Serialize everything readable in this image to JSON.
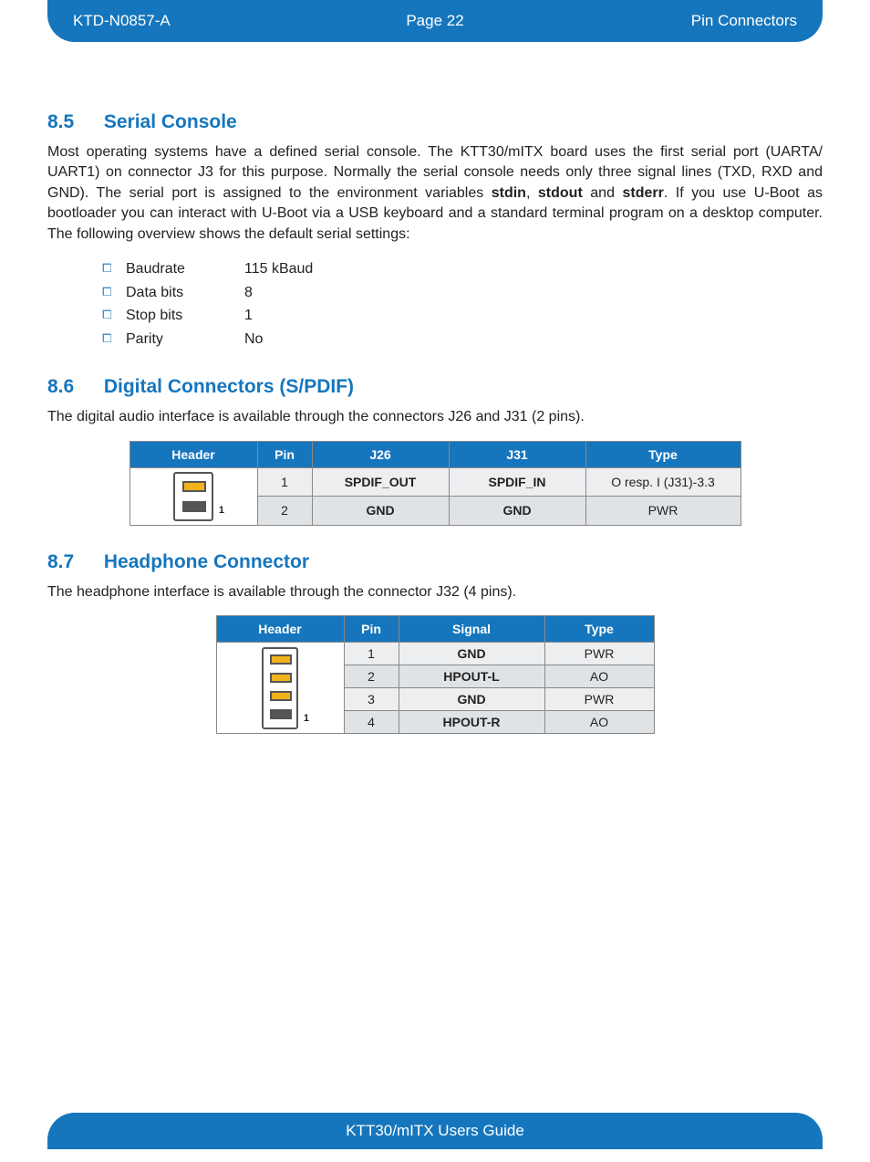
{
  "header": {
    "left": "KTD-N0857-A",
    "mid": "Page 22",
    "right": "Pin Connectors"
  },
  "footer": "KTT30/mITX Users Guide",
  "s85": {
    "num": "8.5",
    "title": "Serial Console",
    "para_pre": "Most operating systems have a defined serial console. The KTT30/mITX board uses the first serial port (UARTA/ UART1) on connector J3 for this purpose. Normally the serial console needs only three signal lines (TXD, RXD and GND). The serial port is assigned to the environment variables ",
    "b1": "stdin",
    "c1": ", ",
    "b2": "stdout",
    "c2": " and ",
    "b3": "stderr",
    "para_post": ". If you use U-Boot as bootloader you can interact with U-Boot via a USB keyboard and a standard terminal program on a desktop computer. The following overview shows the default serial settings:",
    "bullets": [
      {
        "label": "Baudrate",
        "value": "115 kBaud"
      },
      {
        "label": "Data bits",
        "value": "8"
      },
      {
        "label": "Stop bits",
        "value": "1"
      },
      {
        "label": "Parity",
        "value": "No"
      }
    ]
  },
  "s86": {
    "num": "8.6",
    "title": "Digital Connectors (S/PDIF)",
    "para": "The digital audio interface is available through the connectors J26 and J31 (2 pins).",
    "th": {
      "c0": "Header",
      "c1": "Pin",
      "c2": "J26",
      "c3": "J31",
      "c4": "Type"
    },
    "r1": {
      "pin": "1",
      "j26": "SPDIF_OUT",
      "j31": "SPDIF_IN",
      "type": "O resp. I (J31)-3.3"
    },
    "r2": {
      "pin": "2",
      "j26": "GND",
      "j31": "GND",
      "type": "PWR"
    },
    "hdrlbl": "1"
  },
  "s87": {
    "num": "8.7",
    "title": "Headphone Connector",
    "para": "The headphone interface is available through the connector J32 (4 pins).",
    "th": {
      "c0": "Header",
      "c1": "Pin",
      "c2": "Signal",
      "c3": "Type"
    },
    "r1": {
      "pin": "1",
      "sig": "GND",
      "type": "PWR"
    },
    "r2": {
      "pin": "2",
      "sig": "HPOUT-L",
      "type": "AO"
    },
    "r3": {
      "pin": "3",
      "sig": "GND",
      "type": "PWR"
    },
    "r4": {
      "pin": "4",
      "sig": "HPOUT-R",
      "type": "AO"
    },
    "hdrlbl": "1"
  }
}
